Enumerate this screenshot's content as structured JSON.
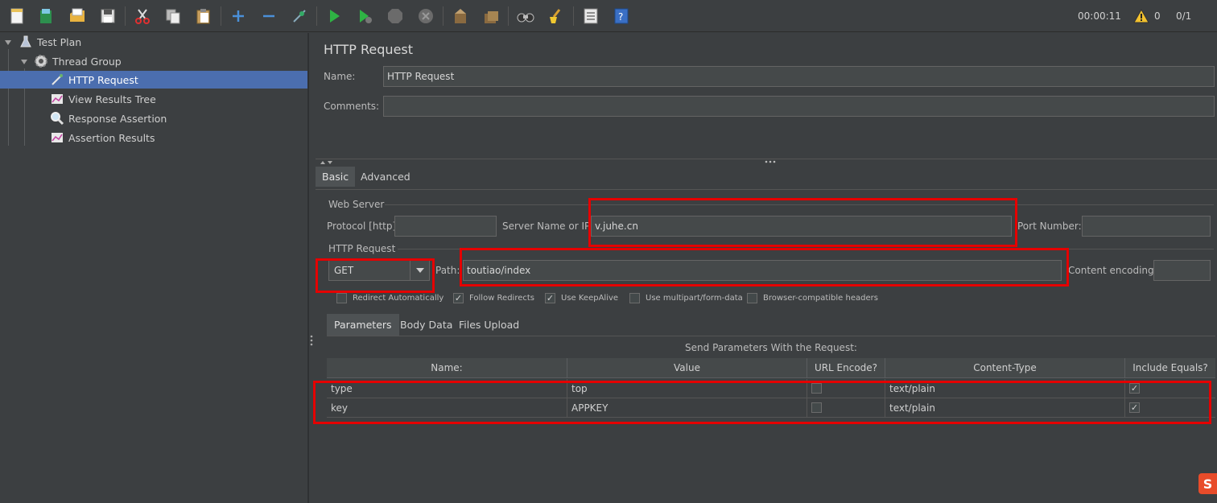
{
  "toolbar": {
    "icons": [
      "new-icon",
      "templates-icon",
      "open-icon",
      "save-icon",
      "cut-icon",
      "copy-icon",
      "paste-icon",
      "expand-icon",
      "collapse-icon",
      "toggle-icon",
      "start-icon",
      "start-no-pause-icon",
      "stop-icon",
      "shutdown-icon",
      "clear-icon",
      "clear-all-icon",
      "search-icon",
      "reset-search-icon",
      "function-helper-icon",
      "help-icon"
    ],
    "elapsed_time": "00:00:11",
    "warning_count": "0",
    "threads": "0/1"
  },
  "tree": {
    "items": [
      {
        "label": "Test Plan",
        "icon": "test-plan-icon"
      },
      {
        "label": "Thread Group",
        "icon": "gear-icon"
      },
      {
        "label": "HTTP Request",
        "icon": "pipette-icon"
      },
      {
        "label": "View Results Tree",
        "icon": "graph-icon"
      },
      {
        "label": "Response Assertion",
        "icon": "magnifier-icon"
      },
      {
        "label": "Assertion Results",
        "icon": "graph-icon"
      }
    ],
    "selected_index": 2
  },
  "panel": {
    "title": "HTTP Request",
    "name_label": "Name:",
    "name_value": "HTTP Request",
    "comments_label": "Comments:",
    "comments_value": "",
    "tabs": [
      "Basic",
      "Advanced"
    ],
    "active_tab": "Basic",
    "web_server": {
      "group_title": "Web Server",
      "protocol_label": "Protocol [http]:",
      "protocol_value": "",
      "server_label": "Server Name or IP:",
      "server_value": "v.juhe.cn",
      "port_label": "Port Number:",
      "port_value": ""
    },
    "http_request": {
      "group_title": "HTTP Request",
      "method": "GET",
      "path_label": "Path:",
      "path_value": "toutiao/index",
      "encoding_label": "Content encoding:",
      "encoding_value": ""
    },
    "options": [
      {
        "label": "Redirect Automatically",
        "checked": false
      },
      {
        "label": "Follow Redirects",
        "checked": true
      },
      {
        "label": "Use KeepAlive",
        "checked": true
      },
      {
        "label": "Use multipart/form-data",
        "checked": false
      },
      {
        "label": "Browser-compatible headers",
        "checked": false
      }
    ],
    "sub_tabs": [
      "Parameters",
      "Body Data",
      "Files Upload"
    ],
    "active_sub_tab": "Parameters",
    "params_caption": "Send Parameters With the Request:",
    "columns": [
      "Name:",
      "Value",
      "URL Encode?",
      "Content-Type",
      "Include Equals?"
    ],
    "rows": [
      {
        "name": "type",
        "value": "top",
        "url_encode": false,
        "content_type": "text/plain",
        "include_equals": true
      },
      {
        "name": "key",
        "value": "APPKEY",
        "url_encode": false,
        "content_type": "text/plain",
        "include_equals": true
      }
    ]
  },
  "colors": {
    "background": "#3c3f41",
    "selection": "#4b6eaf",
    "highlight_box": "#e50000"
  }
}
